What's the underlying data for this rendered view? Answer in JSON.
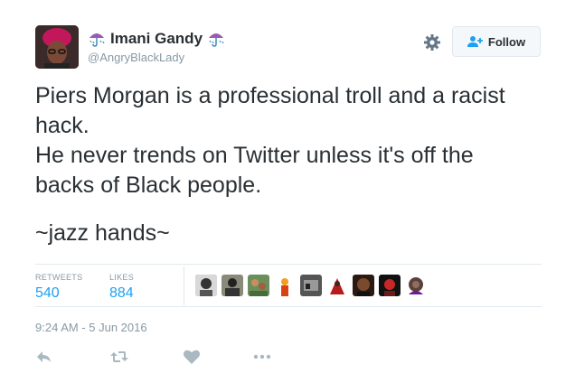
{
  "user": {
    "name": "Imani Gandy",
    "handle": "@AngryBlackLady"
  },
  "follow_button": {
    "label": "Follow"
  },
  "tweet": {
    "lines": [
      "Piers Morgan is a professional troll and a racist",
      "hack.",
      "He never trends on Twitter unless it's off the",
      "backs of Black people.",
      "~jazz hands~"
    ]
  },
  "stats": {
    "retweets_label": "RETWEETS",
    "retweets_count": "540",
    "likes_label": "LIKES",
    "likes_count": "884"
  },
  "timestamp": "9:24 AM - 5 Jun 2016",
  "colors": {
    "accent": "#1da1f2",
    "muted": "#8899a6",
    "text": "#292f33",
    "umbrella": "#9b59b6"
  },
  "icons": {
    "name_decoration": "umbrella-icon",
    "settings": "gear-icon",
    "follow": "add-user-icon",
    "reply": "reply-icon",
    "retweet": "retweet-icon",
    "like": "heart-icon",
    "more": "more-icon"
  }
}
